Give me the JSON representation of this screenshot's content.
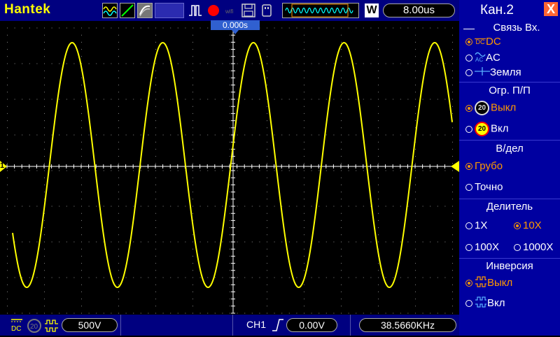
{
  "header": {
    "brand": "Hantek",
    "timebase": "8.00us",
    "trigger_position": "0.000s",
    "acquire_mode_letter": "W"
  },
  "footer": {
    "channel_scale": "500V",
    "trigger_source": "CH1",
    "trigger_level": "0.00V",
    "frequency": "38.5660KHz"
  },
  "markers": {
    "channel_marker": "1"
  },
  "sidebar": {
    "title": "Кан.2",
    "close_label": "X",
    "coupling": {
      "title": "Связь Вх.",
      "options": [
        {
          "label": "DC",
          "selected": true
        },
        {
          "label": "AC",
          "selected": false
        },
        {
          "label": "Земля",
          "selected": false
        }
      ]
    },
    "bandwidth": {
      "title": "Огр. П/П",
      "badge": "20",
      "options": [
        {
          "label": "Выкл",
          "selected": true
        },
        {
          "label": "Вкл",
          "selected": false
        }
      ]
    },
    "volts_div": {
      "title": "В/дел",
      "options": [
        {
          "label": "Грубо",
          "selected": true
        },
        {
          "label": "Точно",
          "selected": false
        }
      ]
    },
    "probe": {
      "title": "Делитель",
      "options": [
        {
          "label": "1X",
          "selected": false
        },
        {
          "label": "10X",
          "selected": true
        },
        {
          "label": "100X",
          "selected": false
        },
        {
          "label": "1000X",
          "selected": false
        }
      ]
    },
    "invert": {
      "title": "Инверсия",
      "options": [
        {
          "label": "Выкл",
          "selected": true
        },
        {
          "label": "Вкл",
          "selected": false
        }
      ]
    }
  },
  "colors": {
    "trace": "#ffff00",
    "panel": "#0000a0",
    "bar": "#000080",
    "selected": "#ff9900"
  }
}
